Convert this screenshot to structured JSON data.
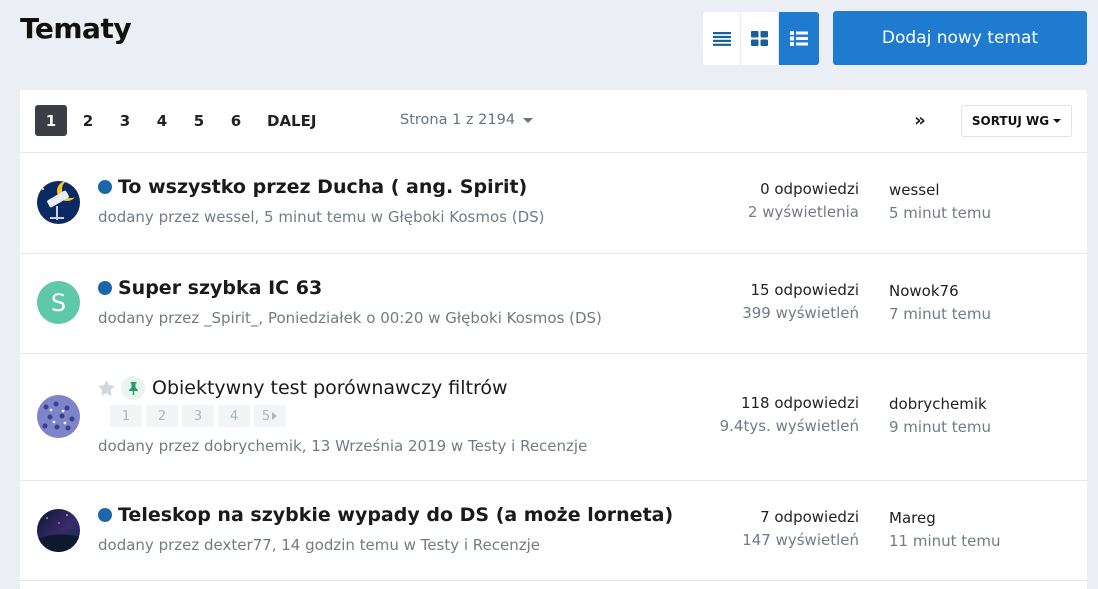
{
  "header": {
    "title": "Tematy",
    "new_topic_label": "Dodaj nowy temat",
    "accent_color": "#1f7bd0"
  },
  "view_modes": [
    {
      "name": "table-view",
      "icon": "list-rows-icon",
      "active": false
    },
    {
      "name": "grid-view",
      "icon": "grid-icon",
      "active": false
    },
    {
      "name": "list-view",
      "icon": "list-bullets-icon",
      "active": true
    }
  ],
  "pagination": {
    "pages": [
      "1",
      "2",
      "3",
      "4",
      "5",
      "6"
    ],
    "current": "1",
    "next_label": "DALEJ",
    "last_label": "»",
    "page_of": "Strona 1 z 2194",
    "sort_label": "SORTUJ WG"
  },
  "topics": [
    {
      "title": "To wszystko przez Ducha ( ang. Spirit)",
      "meta": "dodany przez wessel, 5 minut temu w Głęboki Kosmos (DS)",
      "replies": "0 odpowiedzi",
      "views": "2 wyświetlenia",
      "last_user": "wessel",
      "last_time": "5 minut temu",
      "avatar": "telescope-avatar",
      "unread": true
    },
    {
      "title": "Super szybka IC 63",
      "meta": "dodany przez _Spirit_, Poniedziałek o 00:20 w Głęboki Kosmos (DS)",
      "replies": "15 odpowiedzi",
      "views": "399 wyświetleń",
      "last_user": "Nowok76",
      "last_time": "7 minut temu",
      "avatar_letter": "S",
      "unread": true
    },
    {
      "title": "Obiektywny test porównawczy filtrów",
      "meta": "dodany przez dobrychemik, 13 Września 2019 w Testy i Recenzje",
      "replies": "118 odpowiedzi",
      "views": "9.4tys. wyświetleń",
      "last_user": "dobrychemik",
      "last_time": "9 minut temu",
      "avatar": "molecule-avatar",
      "pinned": true,
      "mini_pages": [
        "1",
        "2",
        "3",
        "4",
        "5"
      ]
    },
    {
      "title": "Teleskop na szybkie wypady do DS (a może lorneta)",
      "meta": "dodany przez dexter77, 14 godzin temu w Testy i Recenzje",
      "replies": "7 odpowiedzi",
      "views": "147 wyświetleń",
      "last_user": "Mareg",
      "last_time": "11 minut temu",
      "avatar": "night-sky-avatar",
      "unread": true
    }
  ]
}
